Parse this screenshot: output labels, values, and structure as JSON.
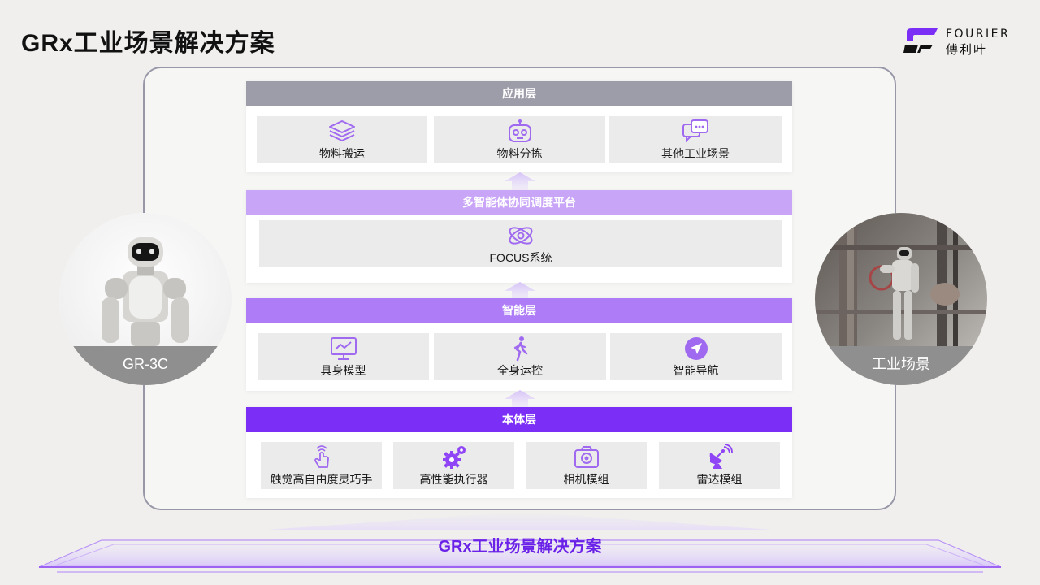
{
  "title": "GRx工业场景解决方案",
  "logo": {
    "en": "FOURIER",
    "cn": "傅利叶"
  },
  "left_circle": {
    "label": "GR-3C"
  },
  "right_circle": {
    "label": "工业场景"
  },
  "layers": {
    "application": {
      "title": "应用层",
      "color": "#9d9ca9",
      "items": [
        {
          "label": "物料搬运",
          "icon": "layers-icon"
        },
        {
          "label": "物料分拣",
          "icon": "robot-head-icon"
        },
        {
          "label": "其他工业场景",
          "icon": "chat-bubbles-icon"
        }
      ]
    },
    "platform": {
      "title": "多智能体协同调度平台",
      "color": "#c9a5f7",
      "items": [
        {
          "label": "FOCUS系统",
          "icon": "atom-orbit-icon"
        }
      ]
    },
    "intelligence": {
      "title": "智能层",
      "color": "#ad7cf6",
      "items": [
        {
          "label": "具身模型",
          "icon": "monitor-chart-icon"
        },
        {
          "label": "全身运控",
          "icon": "walking-person-icon"
        },
        {
          "label": "智能导航",
          "icon": "navigation-icon"
        }
      ]
    },
    "body": {
      "title": "本体层",
      "color": "#7b2ff6",
      "items": [
        {
          "label": "触觉高自由度灵巧手",
          "icon": "touch-hand-icon"
        },
        {
          "label": "高性能执行器",
          "icon": "gears-icon"
        },
        {
          "label": "相机模组",
          "icon": "camera-icon"
        },
        {
          "label": "雷达模组",
          "icon": "radar-dish-icon"
        }
      ]
    }
  },
  "base_label": "GRx工业场景解决方案",
  "colors": {
    "accent": "#8b3cf6",
    "icon": "#9c5cf4",
    "base_text": "#6b22e8"
  }
}
